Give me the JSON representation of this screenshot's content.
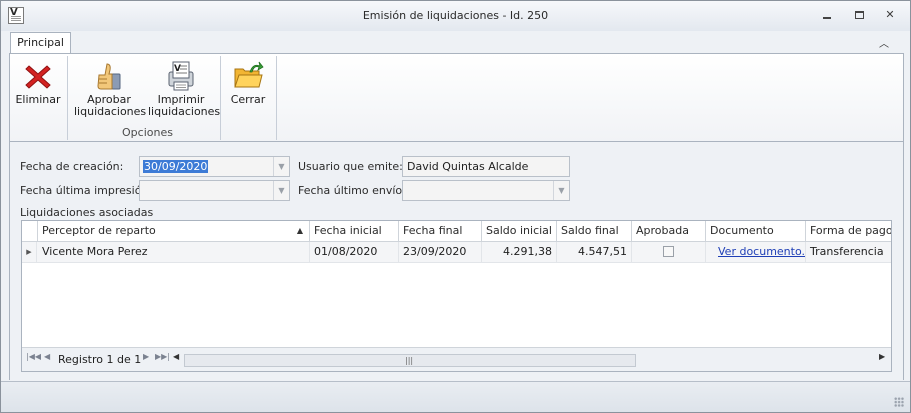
{
  "window": {
    "title": "Emisión de liquidaciones - Id. 250"
  },
  "ribbon": {
    "tab": "Principal",
    "buttons": {
      "eliminar": "Eliminar",
      "aprobar_1": "Aprobar",
      "aprobar_2": "liquidaciones",
      "imprimir_1": "Imprimir",
      "imprimir_2": "liquidaciones",
      "cerrar": "Cerrar"
    },
    "group_opciones": "Opciones"
  },
  "form": {
    "fecha_creacion_label": "Fecha de creación:",
    "fecha_creacion_value": "30/09/2020",
    "usuario_label": "Usuario que emite:",
    "usuario_value": "David Quintas Alcalde",
    "fecha_impresion_label": "Fecha última impresión:",
    "fecha_impresion_value": "",
    "fecha_envio_label": "Fecha último envío:",
    "fecha_envio_value": "",
    "liquidaciones_label": "Liquidaciones asociadas"
  },
  "grid": {
    "columns": {
      "perceptor": "Perceptor de reparto",
      "fecha_inicial": "Fecha inicial",
      "fecha_final": "Fecha final",
      "saldo_inicial": "Saldo inicial",
      "saldo_final": "Saldo final",
      "aprobada": "Aprobada",
      "documento": "Documento",
      "forma_pago": "Forma de pago"
    },
    "rows": [
      {
        "perceptor": "Vicente Mora Perez",
        "fecha_inicial": "01/08/2020",
        "fecha_final": "23/09/2020",
        "saldo_inicial": "4.291,38",
        "saldo_final": "4.547,51",
        "aprobada": false,
        "documento": "Ver documento...",
        "forma_pago": "Transferencia"
      }
    ],
    "footer": {
      "registro": "Registro 1 de 1"
    }
  },
  "colors": {
    "selection": "#3d7bd6",
    "link": "#1f3fb6"
  }
}
